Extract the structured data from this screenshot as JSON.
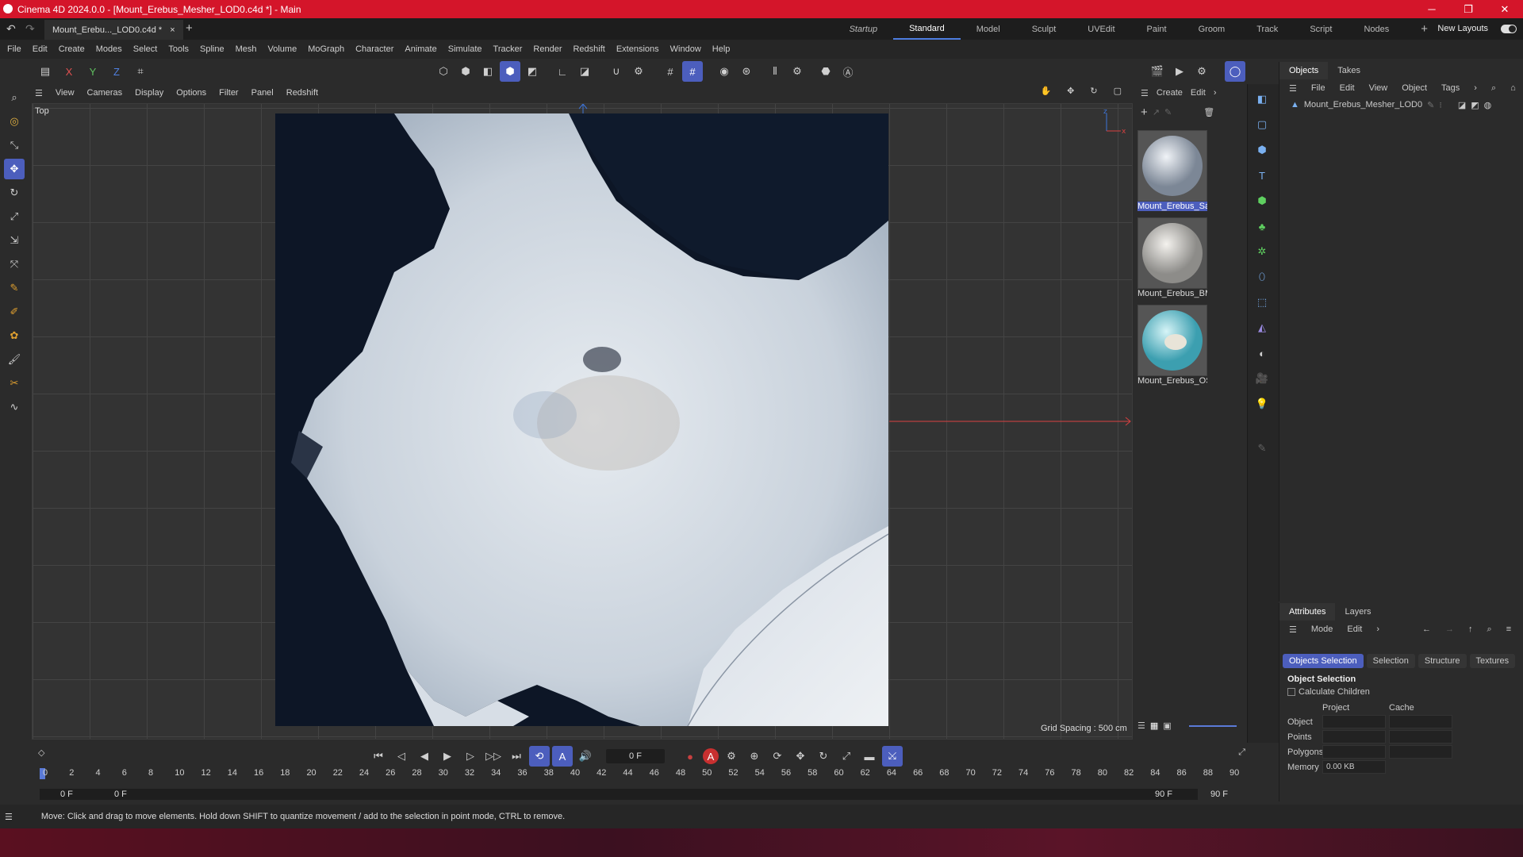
{
  "titlebar": {
    "title": "Cinema 4D 2024.0.0 - [Mount_Erebus_Mesher_LOD0.c4d *] - Main"
  },
  "tabbar": {
    "doc_tab": "Mount_Erebu..._LOD0.c4d *",
    "close": "×",
    "add": "+",
    "layouts": [
      "Startup",
      "Standard",
      "Model",
      "Sculpt",
      "UVEdit",
      "Paint",
      "Groom",
      "Track",
      "Script",
      "Nodes"
    ],
    "active_layout": "Standard",
    "new_layouts": "New Layouts"
  },
  "menubar": {
    "items": [
      "File",
      "Edit",
      "Create",
      "Modes",
      "Select",
      "Tools",
      "Spline",
      "Mesh",
      "Volume",
      "MoGraph",
      "Character",
      "Animate",
      "Simulate",
      "Tracker",
      "Render",
      "Redshift",
      "Extensions",
      "Window",
      "Help"
    ]
  },
  "toolbar": {
    "axis_x": "X",
    "axis_y": "Y",
    "axis_z": "Z"
  },
  "viewport": {
    "menu": [
      "View",
      "Cameras",
      "Display",
      "Options",
      "Filter",
      "Panel",
      "Redshift"
    ],
    "label": "Top",
    "grid_spacing": "Grid Spacing : 500 cm"
  },
  "materials": {
    "menu": [
      "Create",
      "Edit"
    ],
    "items": [
      {
        "name": "Mount_Erebus_Sa"
      },
      {
        "name": "Mount_Erebus_BM"
      },
      {
        "name": "Mount_Erebus_OS"
      }
    ]
  },
  "objects": {
    "tabs": [
      "Objects",
      "Takes"
    ],
    "menu": [
      "File",
      "Edit",
      "View",
      "Object",
      "Tags"
    ],
    "items": [
      {
        "name": "Mount_Erebus_Mesher_LOD0"
      }
    ]
  },
  "attributes": {
    "tabs": [
      "Attributes",
      "Layers"
    ],
    "menu": [
      "Mode",
      "Edit"
    ],
    "subtabs": [
      "Objects Selection",
      "Selection",
      "Structure",
      "Textures"
    ],
    "section": "Object Selection",
    "checkbox": "Calculate Children",
    "columns": [
      "Project",
      "Cache"
    ],
    "rows": [
      {
        "label": "Object",
        "project": "",
        "cache": ""
      },
      {
        "label": "Points",
        "project": "",
        "cache": ""
      },
      {
        "label": "Polygons",
        "project": "",
        "cache": ""
      },
      {
        "label": "Memory",
        "project": "0.00 KB",
        "cache": ""
      }
    ]
  },
  "timeline": {
    "current_frame": "0 F",
    "start_frame": "0 F",
    "start_frame2": "0 F",
    "end_frame": "90 F",
    "end_frame2": "90 F",
    "ticks": [
      "0",
      "2",
      "4",
      "6",
      "8",
      "10",
      "12",
      "14",
      "16",
      "18",
      "20",
      "22",
      "24",
      "26",
      "28",
      "30",
      "32",
      "34",
      "36",
      "38",
      "40",
      "42",
      "44",
      "46",
      "48",
      "50",
      "52",
      "54",
      "56",
      "58",
      "60",
      "62",
      "64",
      "66",
      "68",
      "70",
      "72",
      "74",
      "76",
      "78",
      "80",
      "82",
      "84",
      "86",
      "88",
      "90"
    ]
  },
  "status": {
    "text": "Move: Click and drag to move elements. Hold down SHIFT to quantize movement / add to the selection in point mode, CTRL to remove."
  },
  "colors": {
    "accent": "#4c5ebd",
    "title_bar": "#d4152a"
  }
}
